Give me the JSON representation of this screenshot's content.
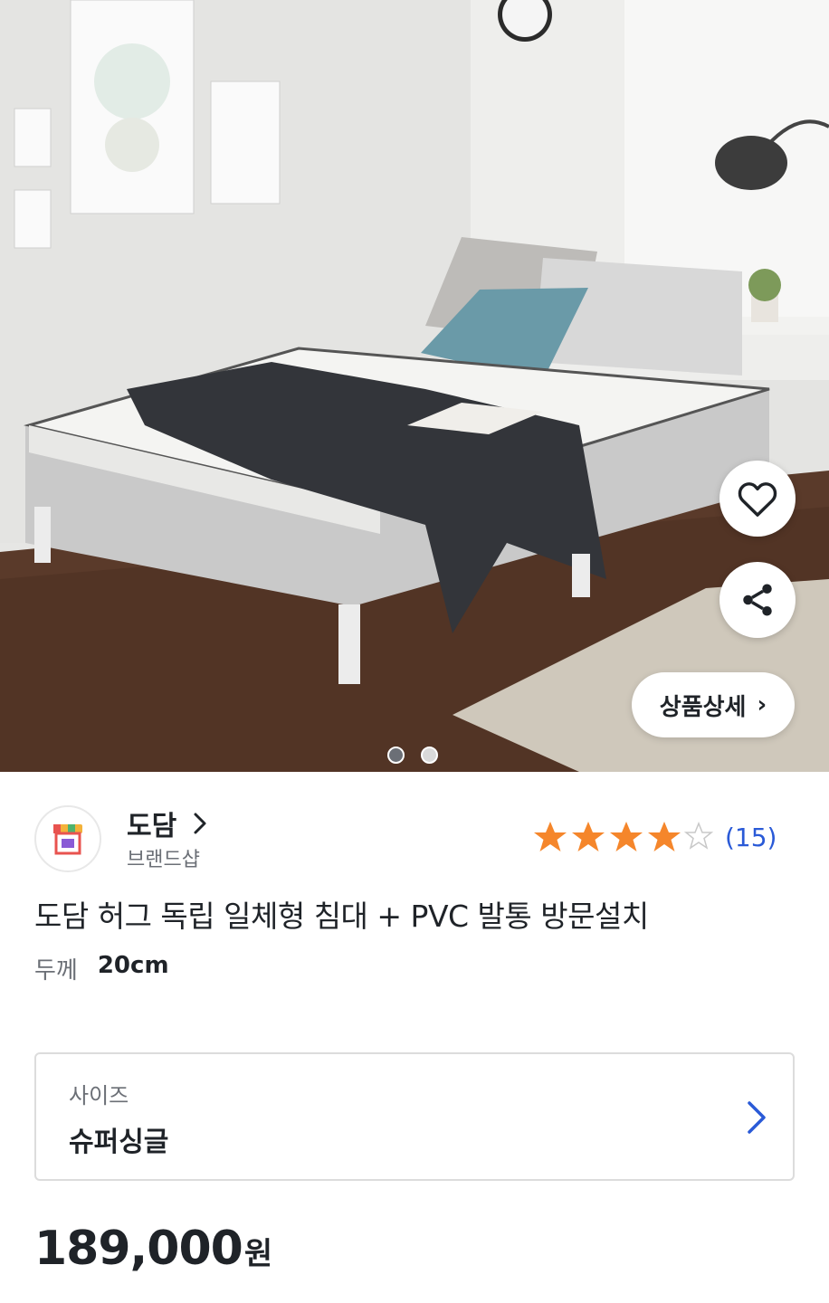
{
  "hero": {
    "detail_button_label": "상품상세",
    "detail_button_chevron": "›",
    "current_image": 1,
    "image_count": 2
  },
  "icons": {
    "favorite": "heart-outline-icon",
    "share": "share-icon",
    "brand_chevron": "chevron-right-icon",
    "option_chevron": "chevron-right-icon"
  },
  "brand": {
    "name": "도담",
    "subtitle": "브랜드샵"
  },
  "rating": {
    "stars": 4,
    "max_stars": 5,
    "count_label": "(15)"
  },
  "product": {
    "title": "도담 허그 독립 일체형 침대 + PVC 발통 방문설치",
    "spec_label": "두께",
    "spec_value": "20cm"
  },
  "option": {
    "label": "사이즈",
    "value": "슈퍼싱글"
  },
  "price": {
    "amount": "189,000",
    "unit": "원"
  },
  "colors": {
    "accent_blue": "#2a5ad7",
    "star_orange": "#f5862b",
    "text_primary": "#1f2328",
    "text_secondary": "#6b6f76"
  }
}
